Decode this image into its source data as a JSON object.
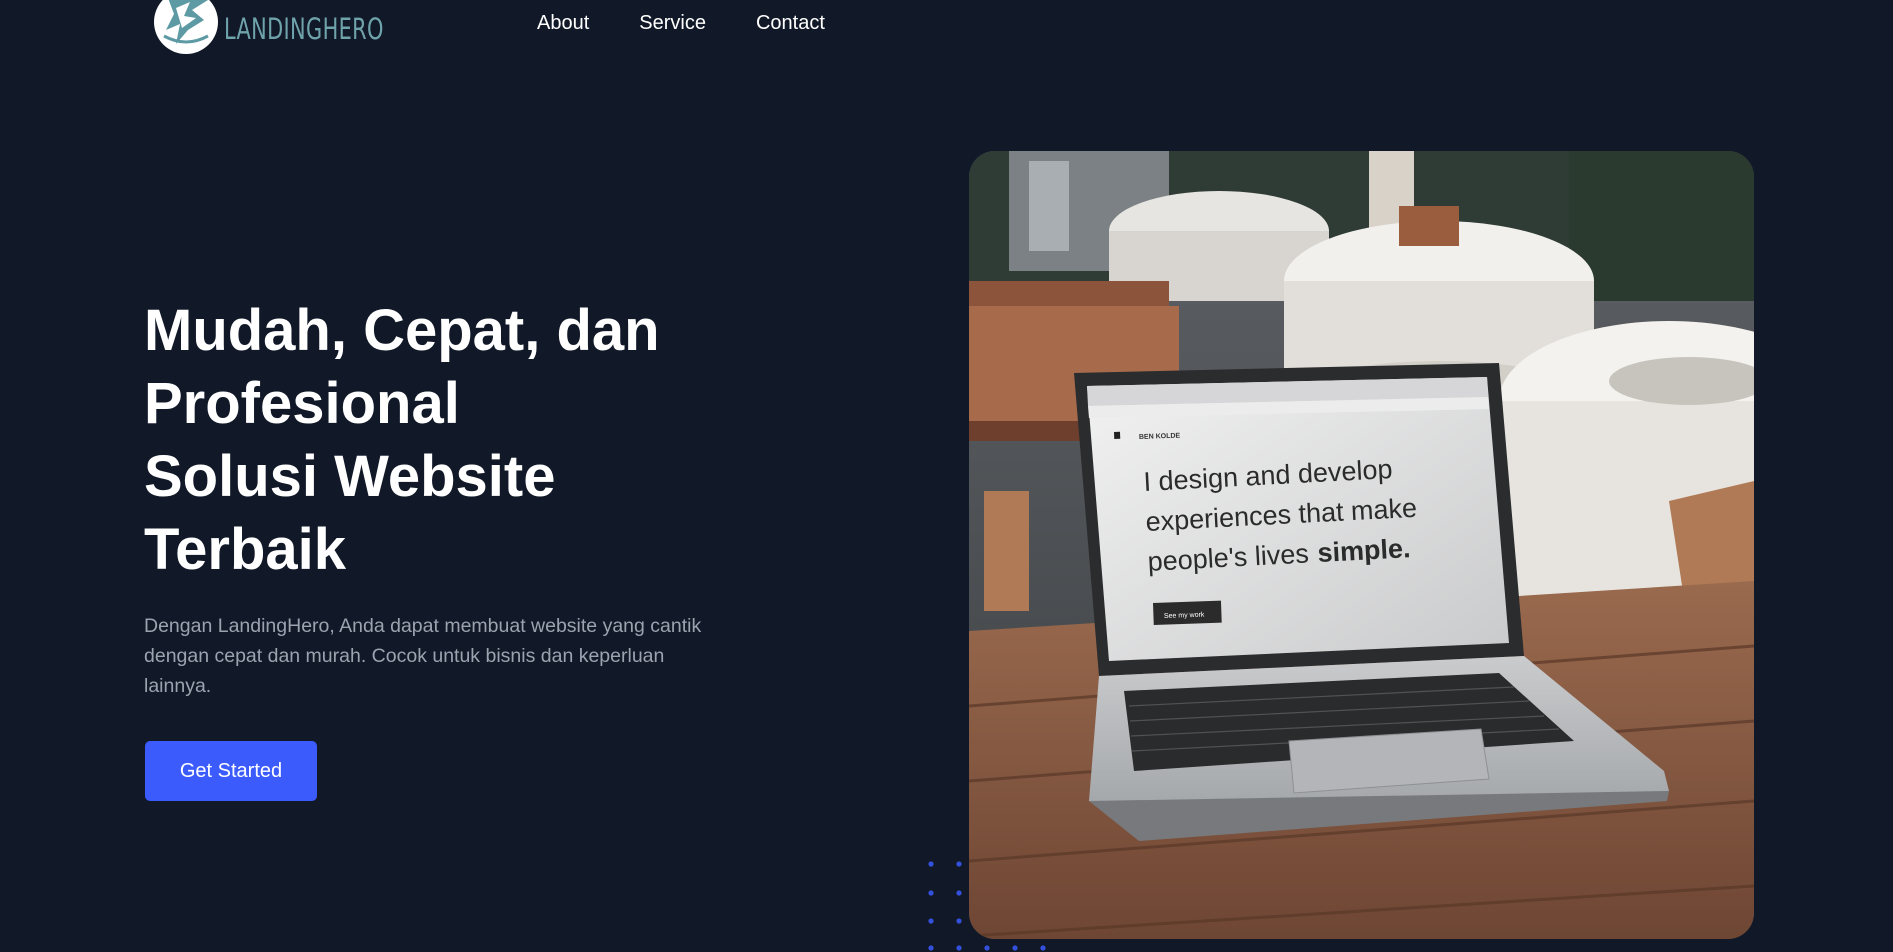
{
  "brand": {
    "name": "LANDINGHERO"
  },
  "nav": {
    "items": [
      "About",
      "Service",
      "Contact"
    ]
  },
  "hero": {
    "title_lines": [
      "Mudah, Cepat, dan",
      "Profesional",
      "Solusi Website",
      "Terbaik"
    ],
    "description": "Dengan LandingHero, Anda dapat membuat website yang cantik dengan cepat dan murah. Cocok untuk bisnis dan keperluan lainnya.",
    "cta_label": "Get Started"
  },
  "photo": {
    "screen_brand": "BEN KOLDE",
    "screen_lines": [
      "I design and develop",
      "experiences that make",
      "people's lives"
    ],
    "screen_emphasis": "simple.",
    "screen_button": "See my work"
  },
  "colors": {
    "background": "#111827",
    "accent": "#3b5bfd",
    "muted_text": "#9ca3af",
    "logo": "#6fa3ab"
  }
}
